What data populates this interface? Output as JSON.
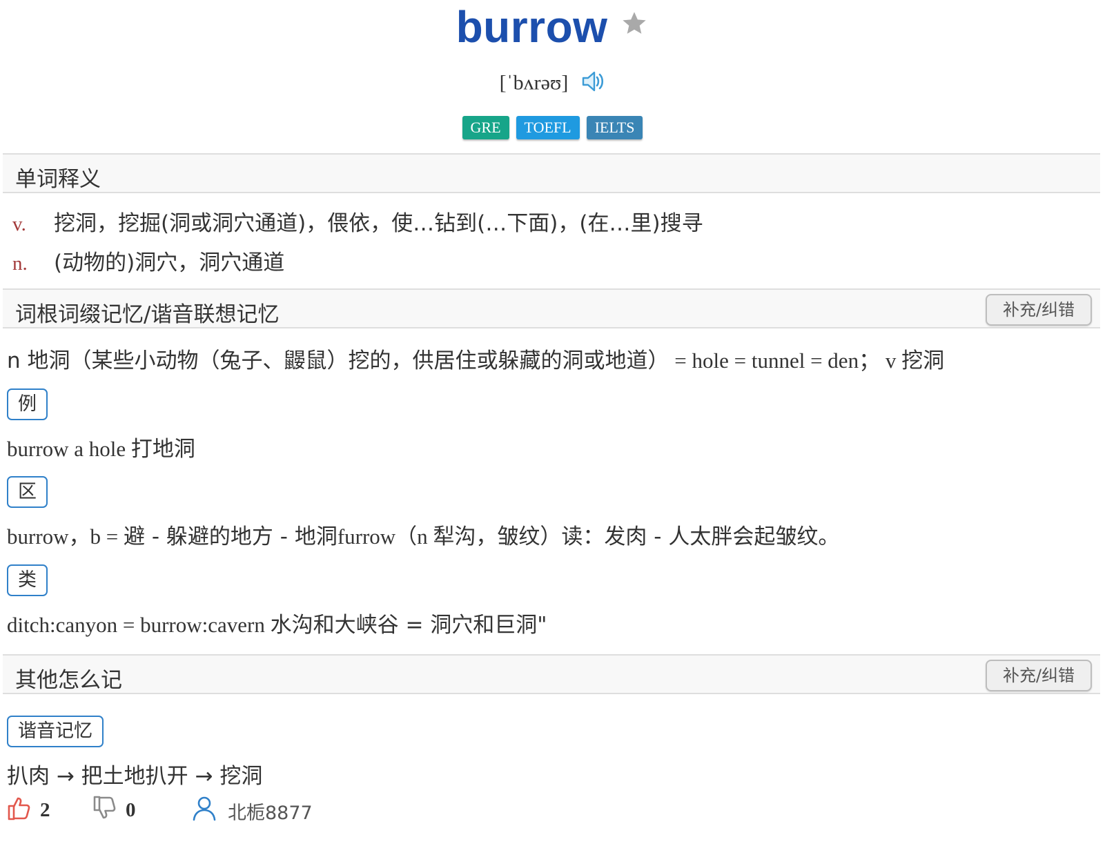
{
  "word": {
    "text": "burrow",
    "phonetic": "[ˈbʌrəʊ]",
    "tags": [
      {
        "label": "GRE",
        "color": "#17a589"
      },
      {
        "label": "TOEFL",
        "color": "#1f9ae0"
      },
      {
        "label": "IELTS",
        "color": "#3a85b5"
      }
    ]
  },
  "definitions": {
    "title": "单词释义",
    "items": [
      {
        "pos": "v.",
        "text": "挖洞，挖掘(洞或洞穴通道)，偎依，使…钻到(…下面)，(在…里)搜寻"
      },
      {
        "pos": "n.",
        "text": "(动物的)洞穴，洞穴通道"
      }
    ]
  },
  "mnemonic": {
    "title": "词根词缀记忆/谐音联想记忆",
    "edit_label": "补充/纠错",
    "line1_cn": "n 地洞（某些小动物（兔子、鼹鼠）挖的，供居住或躲藏的洞或地道）",
    "line1_en": " = hole = tunnel = den； v ",
    "line1_tail": "挖洞",
    "example_badge": "例",
    "example_en": "burrow a hole ",
    "example_cn": "打地洞",
    "distinguish_badge": "区",
    "distinguish_en": "burrow，b = ",
    "distinguish_cn1": "避 - 躲避的地方 - 地洞",
    "distinguish_en2": "furrow（n ",
    "distinguish_cn2": "犁沟，皱纹）读：发肉 - 人太胖会起皱纹。",
    "analogy_badge": "类",
    "analogy_en": "ditch:canyon = burrow:cavern ",
    "analogy_cn": "水沟和大峡谷 = 洞穴和巨洞\""
  },
  "other": {
    "title": "其他怎么记",
    "edit_label": "补充/纠错",
    "badge": "谐音记忆",
    "text": "扒肉 → 把土地扒开 → 挖洞",
    "likes": "2",
    "dislikes": "0",
    "username": "北栀8877"
  }
}
